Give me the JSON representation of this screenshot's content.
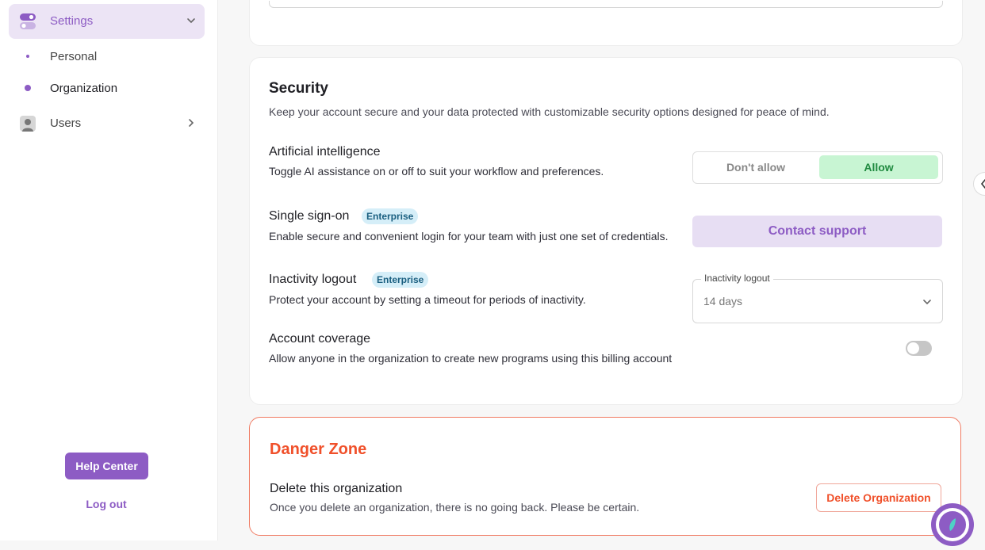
{
  "sidebar": {
    "settings_label": "Settings",
    "sub_items": [
      {
        "label": "Personal",
        "active": false
      },
      {
        "label": "Organization",
        "active": true
      }
    ],
    "users_label": "Users",
    "help_center": "Help Center",
    "logout": "Log out"
  },
  "security": {
    "title": "Security",
    "description": "Keep your account secure and your data protected with customizable security options designed for peace of mind.",
    "ai": {
      "title": "Artificial intelligence",
      "description": "Toggle AI assistance on or off to suit your workflow and preferences.",
      "option_disallow": "Don't allow",
      "option_allow": "Allow",
      "selected": "Allow"
    },
    "sso": {
      "title": "Single sign-on",
      "badge": "Enterprise",
      "description": "Enable secure and convenient login for your team with just one set of credentials.",
      "button": "Contact support"
    },
    "inactivity": {
      "title": "Inactivity logout",
      "badge": "Enterprise",
      "description": "Protect your account by setting a timeout for periods of inactivity.",
      "field_label": "Inactivity logout",
      "value": "14 days"
    },
    "coverage": {
      "title": "Account coverage",
      "description": "Allow anyone in the organization to create new programs using this billing account",
      "enabled": false
    }
  },
  "danger": {
    "title": "Danger Zone",
    "delete_title": "Delete this organization",
    "delete_description": "Once you delete an organization, there is no going back. Please be certain.",
    "delete_button": "Delete Organization"
  },
  "colors": {
    "accent": "#8d5cc4",
    "danger": "#f0502a",
    "allow_bg": "#c8f5d3"
  }
}
